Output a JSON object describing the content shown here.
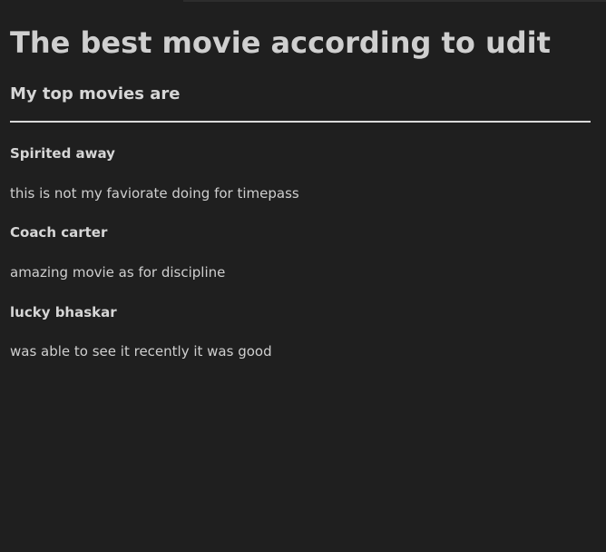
{
  "page": {
    "heading": "The best movie according to udit",
    "subheading": "My top movies are"
  },
  "movies": [
    {
      "title": "Spirited away",
      "note": "this is not my faviorate doing for timepass"
    },
    {
      "title": "Coach carter",
      "note": "amazing movie as for discipline"
    },
    {
      "title": "lucky bhaskar",
      "note": "was able to see it recently it was good"
    }
  ],
  "colors": {
    "background": "#1f1f1f",
    "text": "#d4d4d4",
    "divider": "#d9d9d9"
  }
}
